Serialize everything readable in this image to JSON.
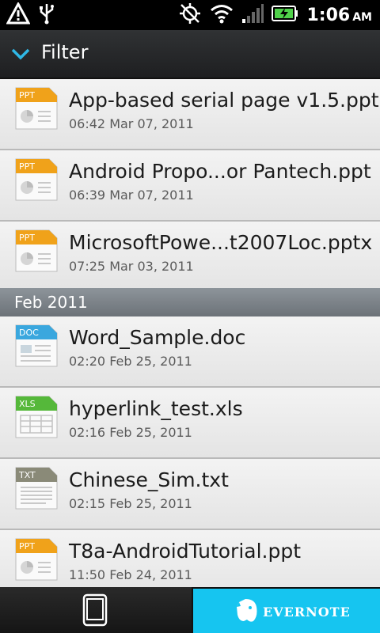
{
  "status_bar": {
    "time": "1:06",
    "ampm": "AM",
    "icons": [
      "alert-icon",
      "usb-icon",
      "gps-icon",
      "wifi-icon",
      "signal-icon",
      "battery-charging-icon"
    ]
  },
  "header": {
    "filter_label": "Filter"
  },
  "files": [
    {
      "name": "App-based serial page v1.5.ppt",
      "date": "06:42 Mar 07, 2011",
      "type": "PPT",
      "color": "#f0a21a"
    },
    {
      "name": "Android Propo...or Pantech.ppt",
      "date": "06:39 Mar 07, 2011",
      "type": "PPT",
      "color": "#f0a21a"
    },
    {
      "name": "MicrosoftPowe...t2007Loc.pptx",
      "date": "07:25 Mar 03, 2011",
      "type": "PPT",
      "color": "#f0a21a"
    }
  ],
  "section": {
    "label": "Feb 2011"
  },
  "files_feb": [
    {
      "name": "Word_Sample.doc",
      "date": "02:20 Feb 25, 2011",
      "type": "DOC",
      "color": "#3aa7de"
    },
    {
      "name": "hyperlink_test.xls",
      "date": "02:16 Feb 25, 2011",
      "type": "XLS",
      "color": "#55b83a"
    },
    {
      "name": "Chinese_Sim.txt",
      "date": "02:15 Feb 25, 2011",
      "type": "TXT",
      "color": "#8a8a78"
    },
    {
      "name": "T8a-AndroidTutorial.ppt",
      "date": "11:50 Feb 24, 2011",
      "type": "PPT",
      "color": "#f0a21a"
    }
  ],
  "bottom": {
    "evernote_label": "EVERNOTE"
  },
  "colors": {
    "accent": "#16c5f0",
    "section": "#7a8086",
    "header": "#2a2b2d"
  }
}
